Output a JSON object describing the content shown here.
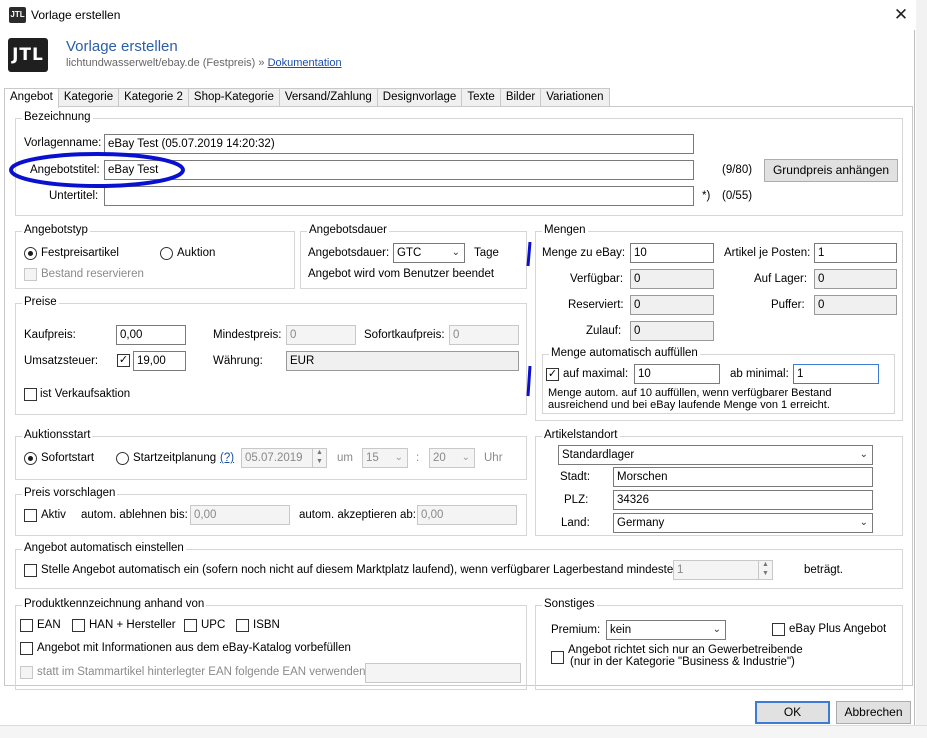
{
  "window": {
    "title": "Vorlage erstellen",
    "logo_text": "JTL",
    "close_glyph": "✕"
  },
  "header": {
    "title": "Vorlage erstellen",
    "subtitle": "lichtundwasserwelt/ebay.de (Festpreis)",
    "sep": "»",
    "doc_link": "Dokumentation"
  },
  "tabs": [
    "Angebot",
    "Kategorie",
    "Kategorie 2",
    "Shop-Kategorie",
    "Versand/Zahlung",
    "Designvorlage",
    "Texte",
    "Bilder",
    "Variationen"
  ],
  "bezeichnung": {
    "title": "Bezeichnung",
    "vorlagenname_label": "Vorlagenname:",
    "vorlagenname_value": "eBay Test  (05.07.2019 14:20:32)",
    "angebotstitel_label": "Angebotstitel:",
    "angebotstitel_value": "eBay Test",
    "angebotstitel_count": "(9/80)",
    "untertitel_label": "Untertitel:",
    "untertitel_value": "",
    "untertitel_star": "*)",
    "untertitel_count": "(0/55)",
    "grundpreis_button": "Grundpreis anhängen"
  },
  "angebotstyp": {
    "title": "Angebotstyp",
    "festpreis": "Festpreisartikel",
    "auktion": "Auktion",
    "bestand": "Bestand reservieren"
  },
  "angebotsdauer": {
    "title": "Angebotsdauer",
    "label": "Angebotsdauer:",
    "value": "GTC",
    "unit": "Tage",
    "note": "Angebot wird vom Benutzer beendet"
  },
  "preise": {
    "title": "Preise",
    "kaufpreis_label": "Kaufpreis:",
    "kaufpreis_value": "0,00",
    "mindestpreis_label": "Mindestpreis:",
    "mindestpreis_value": "0",
    "sofortkauf_label": "Sofortkaufpreis:",
    "sofortkauf_value": "0",
    "ust_label": "Umsatzsteuer:",
    "ust_value": "19,00",
    "waehrung_label": "Währung:",
    "waehrung_value": "EUR",
    "verkaufsaktion": "ist Verkaufsaktion"
  },
  "mengen": {
    "title": "Mengen",
    "menge_ebay_label": "Menge zu eBay:",
    "menge_ebay_value": "10",
    "artikel_posten_label": "Artikel je Posten:",
    "artikel_posten_value": "1",
    "verfuegbar_label": "Verfügbar:",
    "verfuegbar_value": "0",
    "auf_lager_label": "Auf Lager:",
    "auf_lager_value": "0",
    "reserviert_label": "Reserviert:",
    "reserviert_value": "0",
    "puffer_label": "Puffer:",
    "puffer_value": "0",
    "zulauf_label": "Zulauf:",
    "zulauf_value": "0",
    "auto_title": "Menge automatisch auffüllen",
    "auf_maximal_label": "auf maximal:",
    "auf_maximal_value": "10",
    "ab_minimal_label": "ab minimal:",
    "ab_minimal_value": "1",
    "auto_note_1": "Menge autom. auf 10 auffüllen, wenn verfügbarer Bestand",
    "auto_note_2": "ausreichend und bei eBay laufende Menge von 1 erreicht."
  },
  "auktionsstart": {
    "title": "Auktionsstart",
    "sofort": "Sofortstart",
    "zeitplanung": "Startzeitplanung",
    "help": "(?)",
    "date": "05.07.2019",
    "um": "um",
    "hour": "15",
    "minute": "20",
    "colon": ":",
    "uhr": "Uhr"
  },
  "artikelstandort": {
    "title": "Artikelstandort",
    "lager": "Standardlager",
    "stadt_label": "Stadt:",
    "stadt_value": "Morschen",
    "plz_label": "PLZ:",
    "plz_value": "34326",
    "land_label": "Land:",
    "land_value": "Germany"
  },
  "preis_vorschlagen": {
    "title": "Preis vorschlagen",
    "aktiv": "Aktiv",
    "ablehnen_label": "autom. ablehnen bis:",
    "ablehnen_value": "0,00",
    "akzeptieren_label": "autom. akzeptieren ab:",
    "akzeptieren_value": "0,00"
  },
  "angebot_auto": {
    "title": "Angebot automatisch einstellen",
    "text": "Stelle Angebot automatisch ein (sofern noch nicht auf diesem Marktplatz laufend), wenn verfügbarer Lagerbestand mindestens",
    "value": "1",
    "suffix": "beträgt."
  },
  "produkt": {
    "title": "Produktkennzeichnung anhand von",
    "ean": "EAN",
    "han": "HAN + Hersteller",
    "upc": "UPC",
    "isbn": "ISBN",
    "katalog": "Angebot mit Informationen aus dem eBay-Katalog vorbefüllen",
    "stamm": "statt im Stammartikel hinterlegter EAN folgende EAN verwenden:"
  },
  "sonstiges": {
    "title": "Sonstiges",
    "premium_label": "Premium:",
    "premium_value": "kein",
    "ebay_plus": "eBay Plus Angebot",
    "gewerbe_1": "Angebot richtet sich nur an Gewerbetreibende",
    "gewerbe_2": "(nur in der Kategorie \"Business & Industrie\")"
  },
  "footer": {
    "ok": "OK",
    "cancel": "Abbrechen"
  },
  "colors": {
    "title_blue": "#2a5ea8",
    "link_blue": "#1a4fa8",
    "annotation_blue": "#0a10d0",
    "focus_blue": "#3d7bd6"
  }
}
